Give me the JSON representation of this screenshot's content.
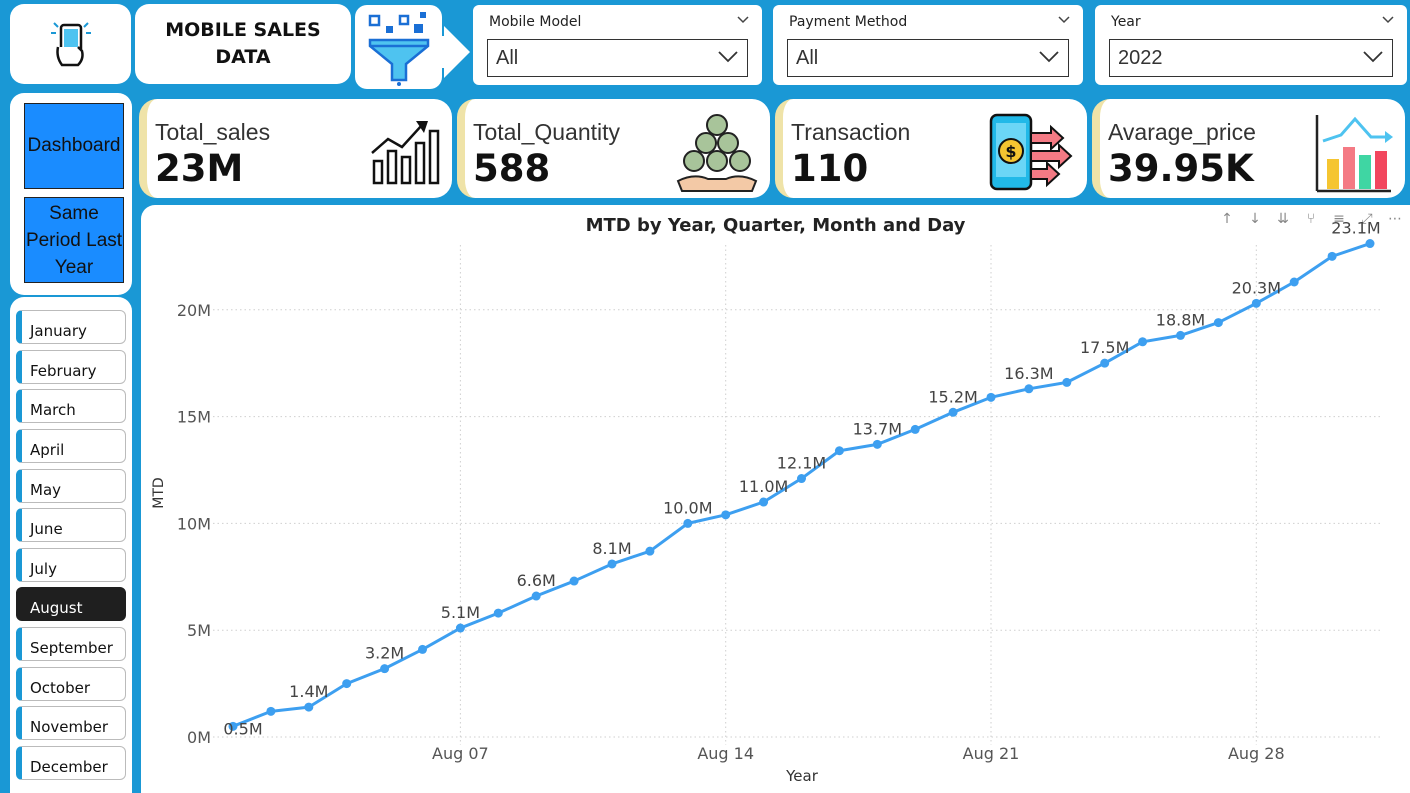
{
  "header": {
    "title": "MOBILE SALES DATA",
    "title_line1": "MOBILE SALES",
    "title_line2": "DATA"
  },
  "filters": [
    {
      "label": "Mobile Model",
      "value": "All"
    },
    {
      "label": "Payment Method",
      "value": "All"
    },
    {
      "label": "Year",
      "value": "2022"
    }
  ],
  "nav": {
    "dashboard": "Dashboard",
    "same_period": "Same Period Last Year"
  },
  "months": [
    "January",
    "February",
    "March",
    "April",
    "May",
    "June",
    "July",
    "August",
    "September",
    "October",
    "November",
    "December"
  ],
  "selected_month": "August",
  "kpis": [
    {
      "label": "Total_sales",
      "value": "23M"
    },
    {
      "label": "Total_Quantity",
      "value": "588"
    },
    {
      "label": "Transaction",
      "value": "110"
    },
    {
      "label": "Avarage_price",
      "value": "39.95K"
    }
  ],
  "colors": {
    "background": "#1a98d5",
    "accent": "#1a8cff",
    "line": "#3d9ff0",
    "active_month": "#1f1f1f"
  },
  "icons": [
    "phone-hand-icon",
    "funnel-icon",
    "arrow-right-icon",
    "growth-chart-icon",
    "coins-hand-icon",
    "phone-payment-icon",
    "bar-chart-icon"
  ],
  "chart_data": {
    "type": "line",
    "title": "MTD by Year, Quarter, Month and Day",
    "xlabel": "Year",
    "ylabel": "MTD",
    "ylim": [
      0,
      23.5
    ],
    "y_unit": "M",
    "y_ticks": [
      "0M",
      "5M",
      "10M",
      "15M",
      "20M"
    ],
    "x_ticks": [
      {
        "label": "Aug 07",
        "day": 7
      },
      {
        "label": "Aug 14",
        "day": 14
      },
      {
        "label": "Aug 21",
        "day": 21
      },
      {
        "label": "Aug 28",
        "day": 28
      }
    ],
    "grid": true,
    "series": [
      {
        "x": [
          1,
          2,
          3,
          4,
          5,
          6,
          7,
          8,
          9,
          10,
          11,
          12,
          13,
          14,
          15,
          16,
          17,
          18,
          19,
          20,
          21,
          22,
          23,
          24,
          25,
          26,
          27,
          28,
          29,
          30,
          31
        ],
        "values": [
          0.5,
          1.2,
          1.4,
          2.5,
          3.2,
          4.1,
          5.1,
          5.8,
          6.6,
          7.3,
          8.1,
          8.7,
          10.0,
          10.4,
          11.0,
          12.1,
          13.4,
          13.7,
          14.4,
          15.2,
          15.9,
          16.3,
          16.6,
          17.5,
          18.5,
          18.8,
          19.4,
          20.3,
          21.3,
          22.5,
          23.1
        ],
        "labels": {
          "1": "0.5M",
          "3": "1.4M",
          "5": "3.2M",
          "7": "5.1M",
          "9": "6.6M",
          "11": "8.1M",
          "13": "10.0M",
          "15": "11.0M",
          "16": "12.1M",
          "18": "13.7M",
          "20": "15.2M",
          "22": "16.3M",
          "24": "17.5M",
          "26": "18.8M",
          "28": "20.3M",
          "31": "23.1M"
        }
      }
    ]
  }
}
